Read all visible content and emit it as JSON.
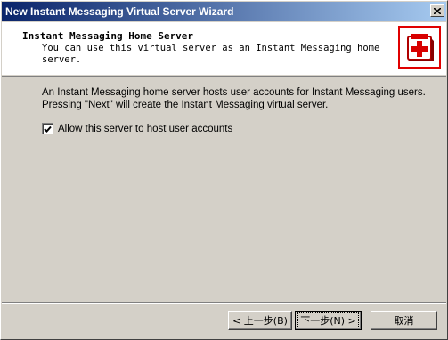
{
  "window": {
    "title": "New Instant Messaging Virtual Server Wizard"
  },
  "header": {
    "title": "Instant Messaging Home Server",
    "subtitle": "You can use this virtual server as an Instant Messaging home\nserver.",
    "icon": "server-medical-icon"
  },
  "body": {
    "description": "An Instant Messaging home server hosts user accounts for Instant Messaging users. Pressing \"Next\" will create the Instant Messaging virtual server.",
    "checkbox": {
      "label": "Allow this server to host user accounts",
      "checked": true
    }
  },
  "buttons": {
    "back": "< 上一步(B)",
    "next": "下一步(N) >",
    "cancel": "取消"
  },
  "colors": {
    "titlebar_start": "#0a246a",
    "titlebar_end": "#a6caf0",
    "icon_red": "#e00000",
    "dialog_bg": "#d4d0c8"
  }
}
